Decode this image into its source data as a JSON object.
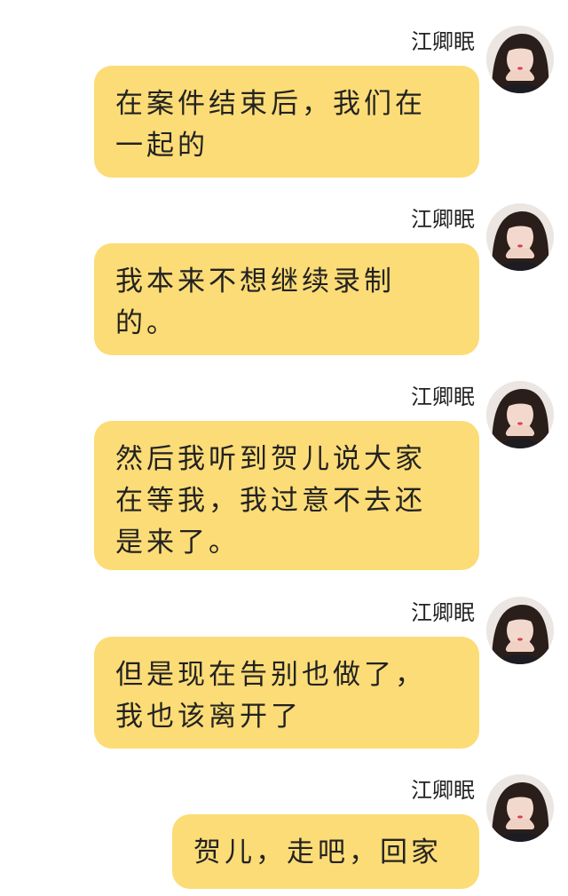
{
  "messages": [
    {
      "sender": "江卿眠",
      "text": "在案件结束后，我们在一起的"
    },
    {
      "sender": "江卿眠",
      "text": "我本来不想继续录制的。"
    },
    {
      "sender": "江卿眠",
      "text": "然后我听到贺儿说大家在等我，我过意不去还是来了。"
    },
    {
      "sender": "江卿眠",
      "text": "但是现在告别也做了，我也该离开了"
    },
    {
      "sender": "江卿眠",
      "text": "贺儿，走吧，回家"
    }
  ],
  "colors": {
    "bubble": "#fcdc76",
    "background": "#ffffff",
    "text": "#222222"
  }
}
